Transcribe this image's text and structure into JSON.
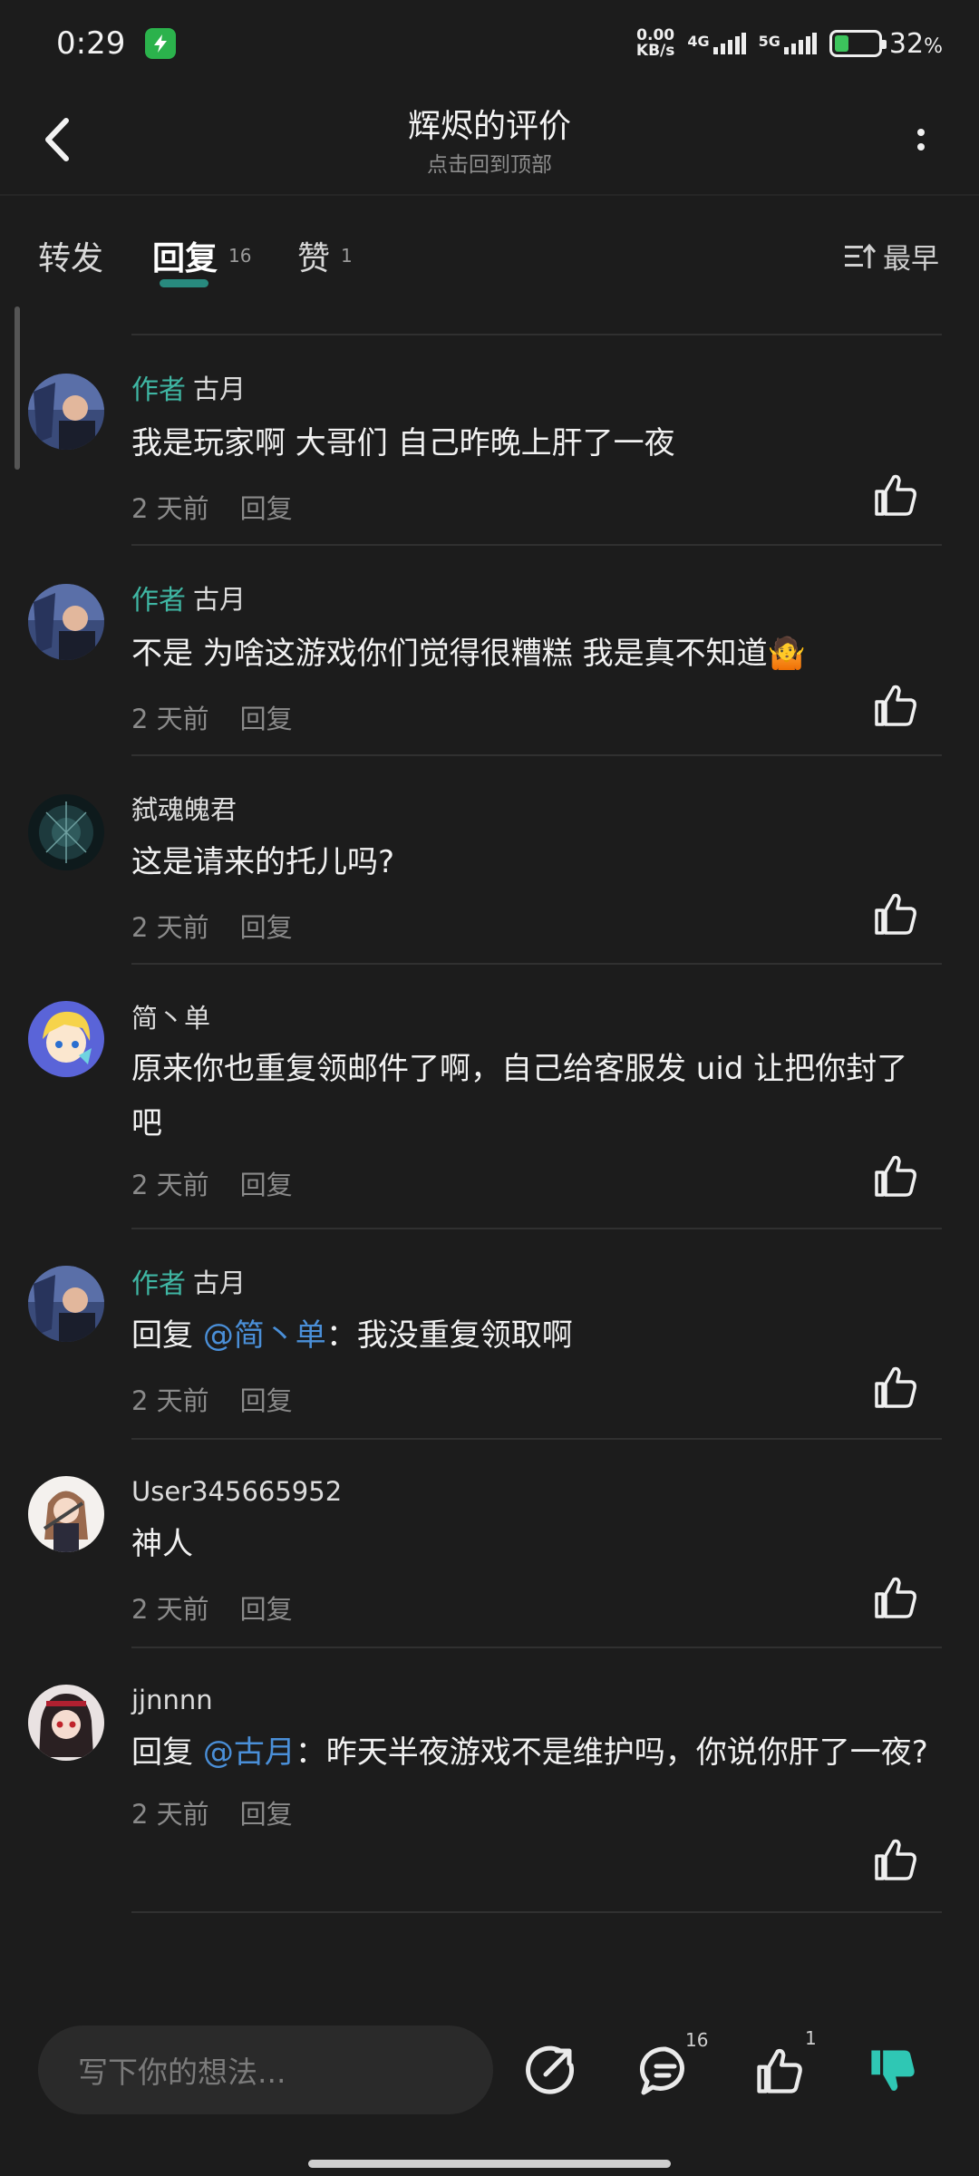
{
  "status_bar": {
    "time": "0:29",
    "net_speed_value": "0.00",
    "net_speed_unit": "KB/s",
    "signal_1": "4G",
    "signal_2": "5G",
    "battery": "32",
    "battery_unit": "%",
    "battery_level": 0.32
  },
  "header": {
    "title": "辉烬的评价",
    "subtitle": "点击回到顶部",
    "back_icon": "chevron-left-icon",
    "more_icon": "more-vertical-icon"
  },
  "tabs": {
    "forward": {
      "label": "转发"
    },
    "reply": {
      "label": "回复",
      "count": "16"
    },
    "like": {
      "label": "赞",
      "count": "1"
    },
    "sort": {
      "label": "最早",
      "icon": "sort-icon"
    }
  },
  "comments": [
    {
      "author_tag": "作者",
      "name": "古月",
      "body": "我是玩家啊 大哥们 自己昨晚上肝了一夜",
      "time": "2 天前",
      "reply": "回复"
    },
    {
      "author_tag": "作者",
      "name": "古月",
      "body": "不是 为啥这游戏你们觉得很糟糕 我是真不知道",
      "emoji": "🤷",
      "time": "2 天前",
      "reply": "回复"
    },
    {
      "name": "弑魂魄君",
      "body": "这是请来的托儿吗?",
      "time": "2 天前",
      "reply": "回复"
    },
    {
      "name": "简丶单",
      "body": "原来你也重复领邮件了啊，自己给客服发 uid 让把你封了吧",
      "time": "2 天前",
      "reply": "回复"
    },
    {
      "author_tag": "作者",
      "name": "古月",
      "prefix": "回复 ",
      "mention": "@简丶单",
      "body": "：我没重复领取啊",
      "time": "2 天前",
      "reply": "回复"
    },
    {
      "name": "User345665952",
      "body": "神人",
      "time": "2 天前",
      "reply": "回复"
    },
    {
      "name": "jjnnnn",
      "prefix": "回复 ",
      "mention": "@古月",
      "body": "：昨天半夜游戏不是维护吗，你说你肝了一夜?",
      "time": "2 天前",
      "reply": "回复"
    }
  ],
  "bottom_bar": {
    "input_placeholder": "写下你的想法...",
    "share_icon": "share-icon",
    "comment_icon": "comment-icon",
    "comment_count": "16",
    "like_icon": "thumbs-up-icon",
    "like_count": "1",
    "dislike_icon": "thumbs-down-icon"
  },
  "colors": {
    "background": "#1c1c1c",
    "accent": "#3fb6a3",
    "mention": "#4a8fd8",
    "dislike_active": "#2fc7b4"
  }
}
